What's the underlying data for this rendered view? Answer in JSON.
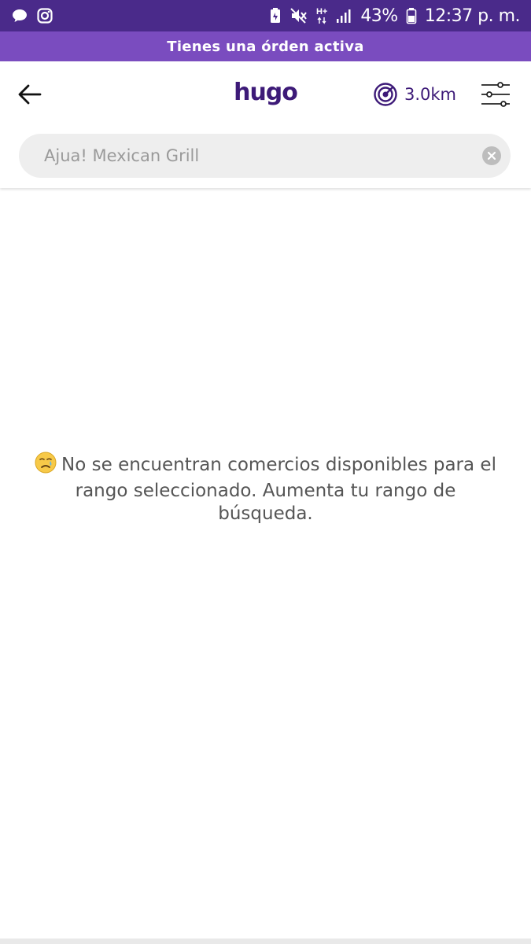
{
  "status_bar": {
    "network_label": "H+",
    "battery_percent": "43%",
    "time": "12:37 p. m.",
    "icons": [
      "chat-bubble-icon",
      "instagram-icon",
      "battery-saver-icon",
      "mute-icon",
      "network-arrows-icon",
      "signal-icon",
      "battery-icon"
    ]
  },
  "banner": {
    "text": "Tienes una órden activa"
  },
  "header": {
    "logo": "hugo",
    "range_label": "3.0km",
    "icons": [
      "back-arrow-icon",
      "radar-icon",
      "sliders-icon"
    ]
  },
  "search": {
    "placeholder": "Ajua! Mexican Grill",
    "value": ""
  },
  "empty_state": {
    "message": "No se encuentran comercios disponibles para el rango seleccionado. Aumenta tu rango de búsqueda.",
    "icon": "crying-face-icon"
  },
  "colors": {
    "status_bar": "#4a2a8a",
    "banner": "#7a4cbf",
    "brand": "#3d1a78"
  }
}
